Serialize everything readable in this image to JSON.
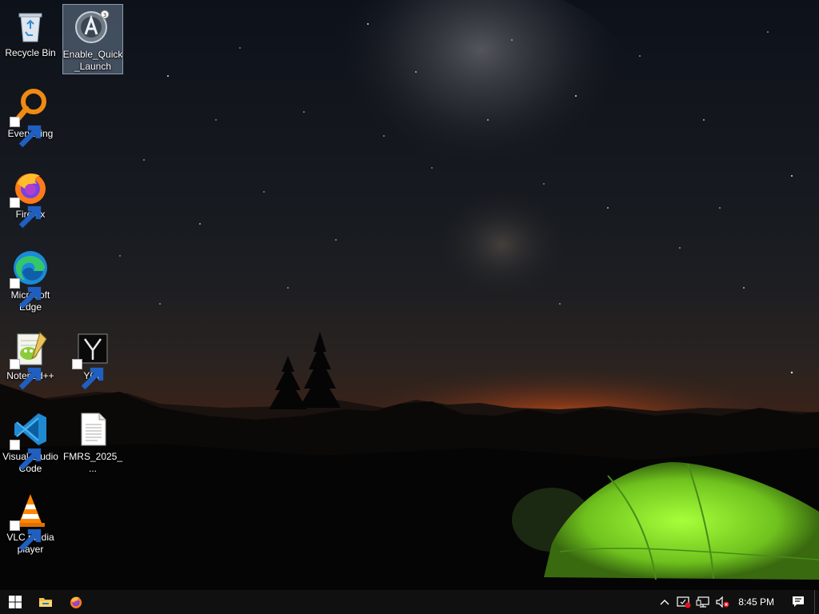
{
  "desktop": {
    "icons": [
      {
        "label": "Recycle Bin",
        "icon": "recycle-bin-icon"
      },
      {
        "label": "Enable_Quick_Launch",
        "icon": "autoit-script-icon",
        "selected": true
      },
      {
        "label": "Everything",
        "icon": "everything-search-icon"
      },
      {
        "label": "Firefox",
        "icon": "firefox-icon"
      },
      {
        "label": "Microsoft Edge",
        "icon": "edge-icon"
      },
      {
        "label": "Notepad++",
        "icon": "notepadpp-icon"
      },
      {
        "label": "YCL",
        "icon": "ycl-icon"
      },
      {
        "label": "Visual Studio Code",
        "icon": "vscode-icon"
      },
      {
        "label": "FMRS_2025_...",
        "icon": "text-file-icon"
      },
      {
        "label": "VLC media player",
        "icon": "vlc-icon"
      }
    ]
  },
  "taskbar": {
    "start": "windows-start-icon",
    "pinned": [
      "file-explorer-icon",
      "firefox-icon"
    ],
    "tray": [
      "show-hidden-icons-chevron-icon",
      "security-alert-icon",
      "network-icon",
      "volume-muted-icon"
    ],
    "time": "8:45 PM",
    "notifications": "action-center-icon"
  },
  "colors": {
    "taskbar": "#101010",
    "selection": "#a0bedc",
    "tent": "#7fd42a",
    "horizon_glow": "#e0661c"
  }
}
